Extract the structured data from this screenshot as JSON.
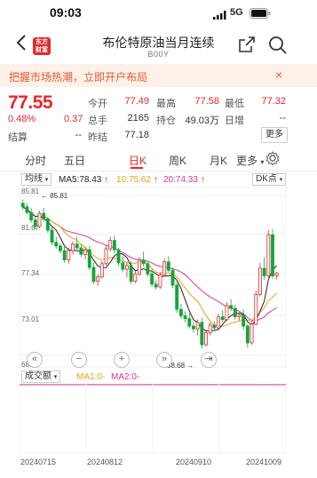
{
  "status": {
    "time": "09:03",
    "network": "5G"
  },
  "nav": {
    "title": "布伦特原油当月连续",
    "code": "B00Y",
    "logo_text": "东方财富"
  },
  "banner": {
    "text": "把握市场热潮，立即开户布局",
    "close": "×"
  },
  "quote": {
    "price": "77.55",
    "change_pct": "0.48%",
    "change_abs": "0.37",
    "fields": [
      {
        "label": "今开",
        "value": "77.49"
      },
      {
        "label": "最高",
        "value": "77.58"
      },
      {
        "label": "最低",
        "value": "77.32"
      },
      {
        "label": "总手",
        "value": "2165"
      },
      {
        "label": "持仓",
        "value": "49.03万"
      },
      {
        "label": "日增",
        "value": "--"
      },
      {
        "label": "结算",
        "value": "--"
      },
      {
        "label": "昨结",
        "value": "77.18"
      }
    ],
    "more_button": "更多"
  },
  "tabs": [
    "分时",
    "五日",
    "日K",
    "周K",
    "月K",
    "更多"
  ],
  "ma": {
    "selector": "均线",
    "ma5": "MA5:78.43",
    "ma10": "10:75.62",
    "ma20": "20:74.33",
    "ma5_color": "#222222",
    "ma10_color": "#e9a21a",
    "ma20_color": "#d6389b",
    "dk_selector": "DK点"
  },
  "chart": {
    "y_ticks": [
      "85.81",
      "81.67",
      "77.34",
      "73.01",
      "68.68"
    ],
    "high_label": "85.81",
    "low_label": "68.68",
    "dates": [
      "20240715",
      "20240812",
      "20240910",
      "20241009"
    ],
    "volume_selector": "成交额",
    "vol_ma1": "MA1:0-",
    "vol_ma2": "MA2:0-",
    "up_color": "#e3292c",
    "down_color": "#17a43a"
  },
  "chart_data": {
    "type": "candlestick",
    "x": [
      "20240715",
      "20240812",
      "20240910",
      "20241009"
    ],
    "candles": [
      [
        85.0,
        85.4,
        84.3,
        84.6
      ],
      [
        84.6,
        85.0,
        83.8,
        84.0
      ],
      [
        84.0,
        84.5,
        82.9,
        83.2
      ],
      [
        83.2,
        83.6,
        82.2,
        82.5
      ],
      [
        82.5,
        84.2,
        82.3,
        83.9
      ],
      [
        83.9,
        84.5,
        83.0,
        83.3
      ],
      [
        83.3,
        83.5,
        81.8,
        82.1
      ],
      [
        82.1,
        82.5,
        80.5,
        80.8
      ],
      [
        80.8,
        81.4,
        80.1,
        80.4
      ],
      [
        80.4,
        80.7,
        79.6,
        79.9
      ],
      [
        79.9,
        80.5,
        78.6,
        78.9
      ],
      [
        78.9,
        80.2,
        78.5,
        79.9
      ],
      [
        79.9,
        80.9,
        79.5,
        80.6
      ],
      [
        80.6,
        81.4,
        80.0,
        80.2
      ],
      [
        80.2,
        80.6,
        79.2,
        79.5
      ],
      [
        79.5,
        80.3,
        79.0,
        80.0
      ],
      [
        80.0,
        80.4,
        77.8,
        78.1
      ],
      [
        78.1,
        78.6,
        76.3,
        76.6
      ],
      [
        76.6,
        77.4,
        76.1,
        77.1
      ],
      [
        77.1,
        78.8,
        76.9,
        78.5
      ],
      [
        78.5,
        80.5,
        78.3,
        80.1
      ],
      [
        80.1,
        81.4,
        79.8,
        81.0
      ],
      [
        81.0,
        81.5,
        79.6,
        80.0
      ],
      [
        80.0,
        80.2,
        78.3,
        78.6
      ],
      [
        78.6,
        79.3,
        77.6,
        77.9
      ],
      [
        77.9,
        78.7,
        77.0,
        78.3
      ],
      [
        78.3,
        78.8,
        76.3,
        76.6
      ],
      [
        76.6,
        77.7,
        76.4,
        77.4
      ],
      [
        77.4,
        79.2,
        77.2,
        78.9
      ],
      [
        78.9,
        79.8,
        78.2,
        78.5
      ],
      [
        78.5,
        78.8,
        77.1,
        77.4
      ],
      [
        77.4,
        77.9,
        76.0,
        76.3
      ],
      [
        76.3,
        76.7,
        75.7,
        76.0
      ],
      [
        76.0,
        77.6,
        75.8,
        77.3
      ],
      [
        77.3,
        79.0,
        77.1,
        78.7
      ],
      [
        78.7,
        79.3,
        77.6,
        77.8
      ],
      [
        77.8,
        78.1,
        75.9,
        76.2
      ],
      [
        76.2,
        76.5,
        73.2,
        73.6
      ],
      [
        73.6,
        74.2,
        72.6,
        72.9
      ],
      [
        72.9,
        73.4,
        72.2,
        72.6
      ],
      [
        72.6,
        73.2,
        71.5,
        71.8
      ],
      [
        71.8,
        72.3,
        71.1,
        71.5
      ],
      [
        71.5,
        72.5,
        70.8,
        72.2
      ],
      [
        72.2,
        72.7,
        69.4,
        69.8
      ],
      [
        69.8,
        71.4,
        69.6,
        71.1
      ],
      [
        71.1,
        72.2,
        70.8,
        71.9
      ],
      [
        71.9,
        72.3,
        71.3,
        71.6
      ],
      [
        71.6,
        73.1,
        71.4,
        72.8
      ],
      [
        72.8,
        73.5,
        72.2,
        72.5
      ],
      [
        72.5,
        74.4,
        72.3,
        74.0
      ],
      [
        74.0,
        74.7,
        73.4,
        73.7
      ],
      [
        73.7,
        74.1,
        72.5,
        72.8
      ],
      [
        72.8,
        73.3,
        72.4,
        73.0
      ],
      [
        73.0,
        73.6,
        71.4,
        71.8
      ],
      [
        71.8,
        72.0,
        69.5,
        70.0
      ],
      [
        70.0,
        72.4,
        69.8,
        72.0
      ],
      [
        72.0,
        75.6,
        71.9,
        75.2
      ],
      [
        75.2,
        78.6,
        75.0,
        78.0
      ],
      [
        78.0,
        79.2,
        76.8,
        77.2
      ],
      [
        77.2,
        82.1,
        77.0,
        81.6
      ],
      [
        81.6,
        82.2,
        76.9,
        77.2
      ],
      [
        77.2,
        77.6,
        76.8,
        77.5
      ]
    ],
    "ma5_last": 78.43,
    "ma10_last": 75.62,
    "ma20_last": 74.33,
    "ylim": [
      68.68,
      85.81
    ]
  }
}
